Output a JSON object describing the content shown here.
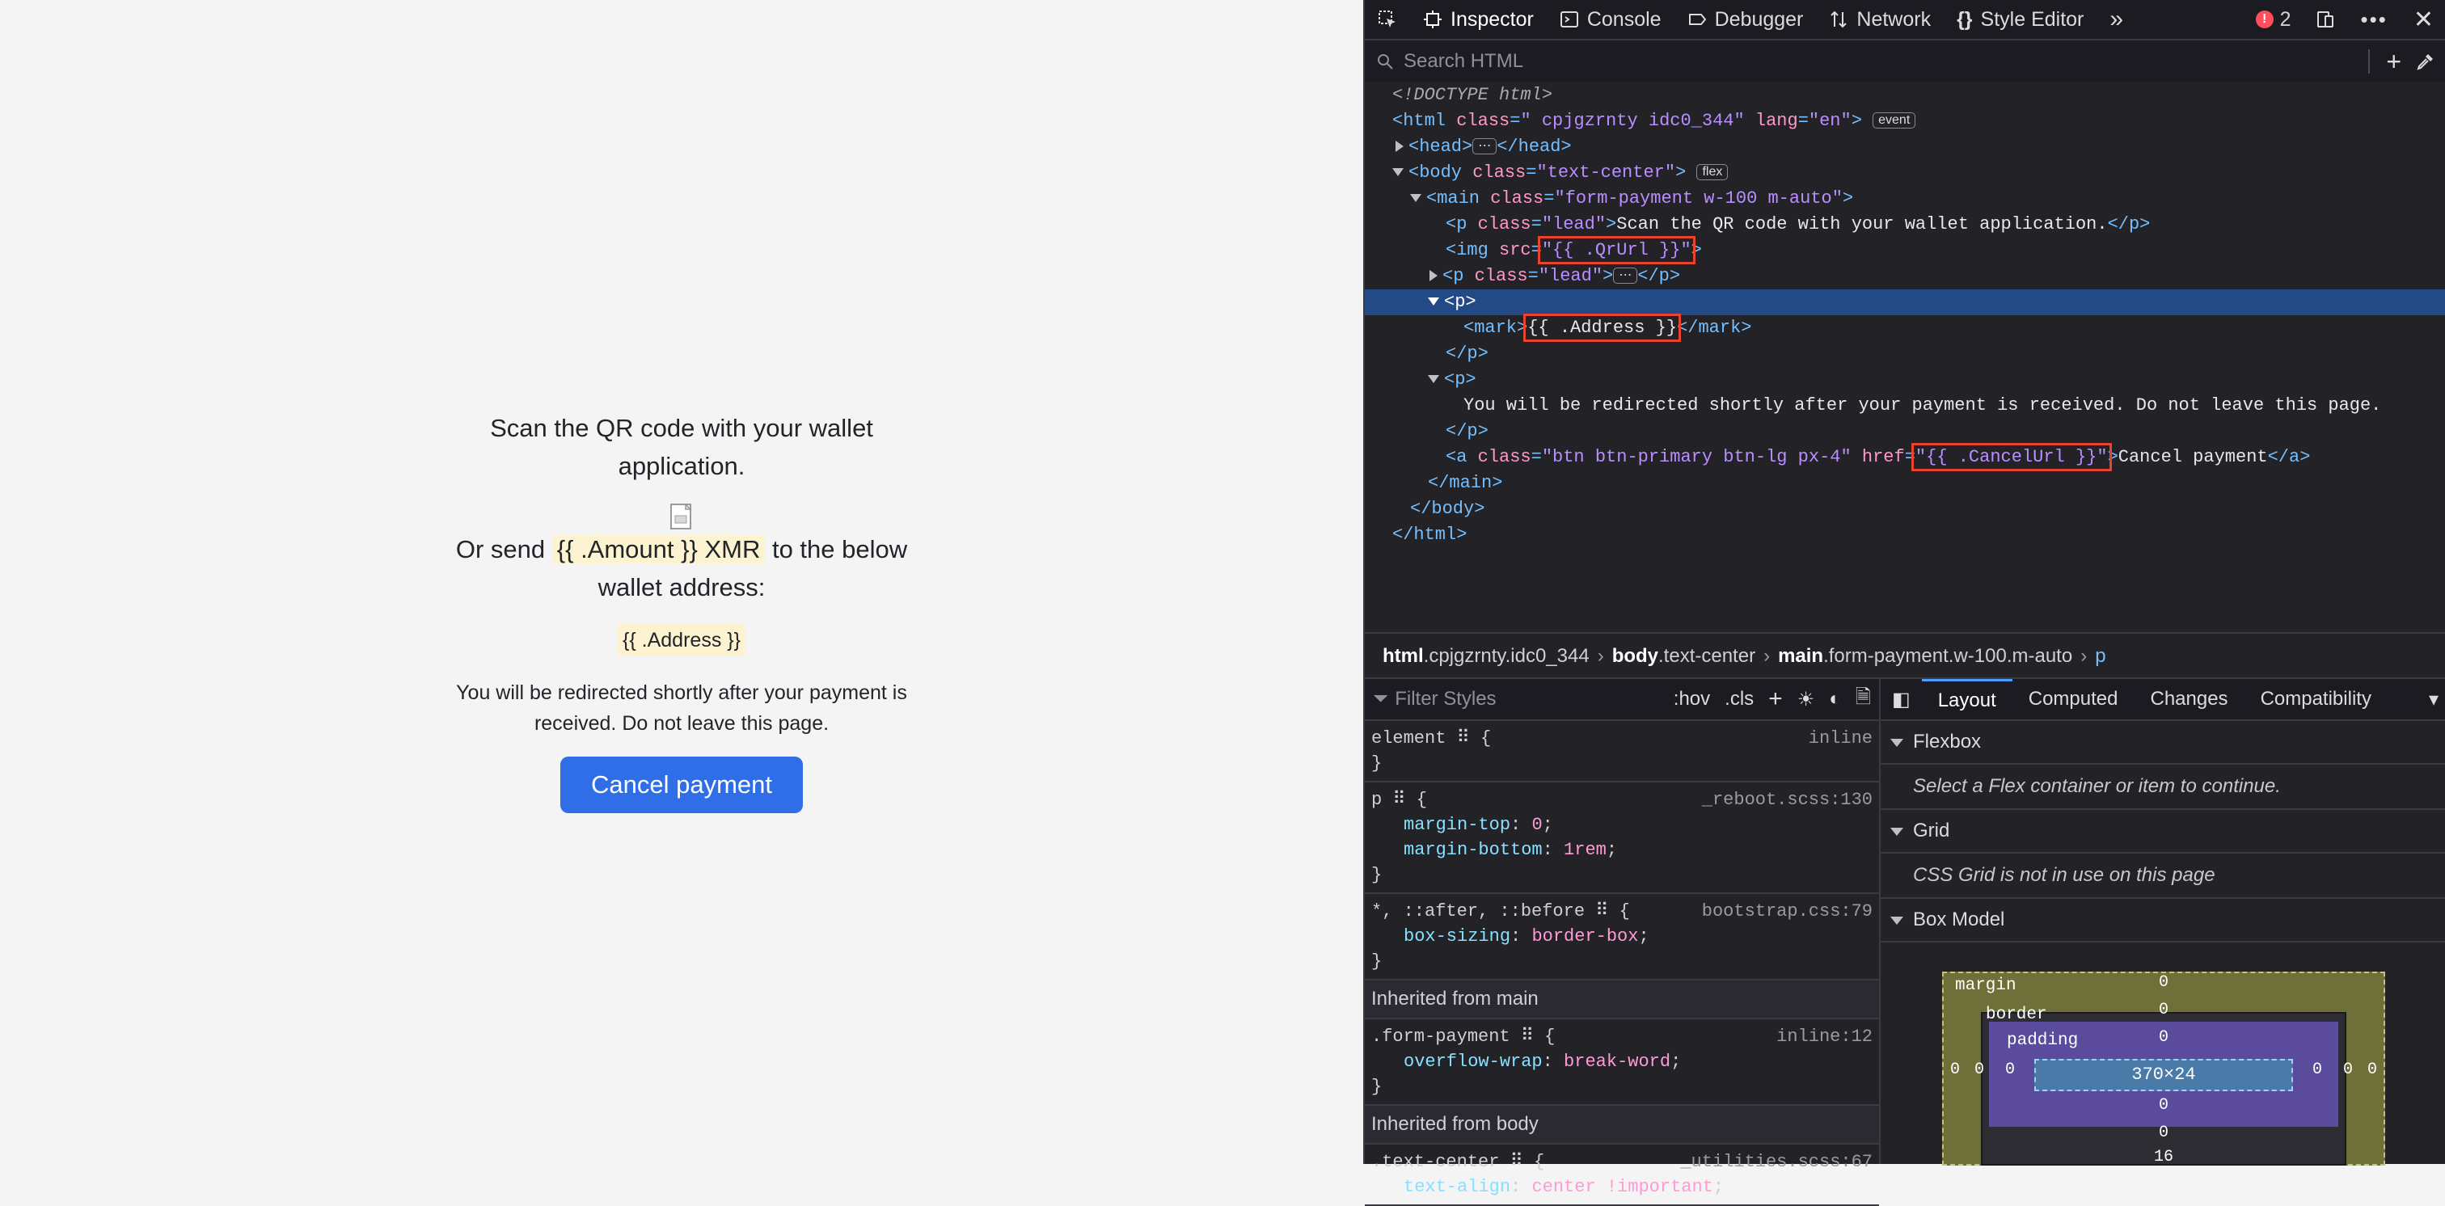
{
  "page": {
    "lead1": "Scan the QR code with your wallet application.",
    "lead2_prefix": "Or send",
    "amount": "{{ .Amount }} XMR",
    "lead2_suffix": "to the below wallet address:",
    "address": "{{ .Address }}",
    "note": "You will be redirected shortly after your payment is received. Do not leave this page.",
    "cancel_button": "Cancel payment"
  },
  "devtools": {
    "tabs": [
      "Inspector",
      "Console",
      "Debugger",
      "Network",
      "Style Editor"
    ],
    "error_count": "2",
    "search_placeholder": "Search HTML",
    "markup": {
      "doctype": "<!DOCTYPE html>",
      "html_class": "\" cpjgzrnty idc0_344\"",
      "html_lang": "\"en\"",
      "event_pill": "event",
      "flex_pill": "flex",
      "body_class": "\"text-center\"",
      "main_class": "\"form-payment w-100 m-auto\"",
      "p_lead_class": "\"lead\"",
      "p_lead_text": "Scan the QR code with your wallet application.",
      "img_src": "\"{{ .QrUrl }}\"",
      "mark_text": "{{ .Address }}",
      "p2_text": "You will be redirected shortly after your payment is received. Do not leave this page.",
      "a_class": "\"btn btn-primary btn-lg px-4\"",
      "a_href": "\"{{ .CancelUrl }}\"",
      "a_text": "Cancel payment"
    },
    "breadcrumbs": [
      {
        "bold": "html",
        "rest": ".cpjgzrnty.idc0_344"
      },
      {
        "bold": "body",
        "rest": ".text-center"
      },
      {
        "bold": "main",
        "rest": ".form-payment.w-100.m-auto"
      },
      {
        "bold": "",
        "rest": "p"
      }
    ],
    "rules": {
      "filter_placeholder": "Filter Styles",
      "hov": ":hov",
      "cls": ".cls",
      "element_selector": "element",
      "element_src": "inline",
      "p_selector": "p",
      "p_src": "_reboot.scss:130",
      "p_prop1_name": "margin-top",
      "p_prop1_val": "0",
      "p_prop2_name": "margin-bottom",
      "p_prop2_val": "1rem",
      "star_selector": "*, ::after, ::before",
      "star_src": "bootstrap.css:79",
      "star_prop_name": "box-sizing",
      "star_prop_val": "border-box",
      "inherit_main": "Inherited from main",
      "fp_selector": ".form-payment",
      "fp_src": "inline:12",
      "fp_prop_name": "overflow-wrap",
      "fp_prop_val": "break-word",
      "inherit_body": "Inherited from body",
      "tc_selector": ".text-center",
      "tc_src": "_utilities.scss:67",
      "tc_prop_name": "text-align",
      "tc_prop_val": "center !important"
    },
    "layout": {
      "tabs": [
        "Layout",
        "Computed",
        "Changes",
        "Compatibility"
      ],
      "flexbox_hdr": "Flexbox",
      "flexbox_msg": "Select a Flex container or item to continue.",
      "grid_hdr": "Grid",
      "grid_msg": "CSS Grid is not in use on this page",
      "boxmodel_hdr": "Box Model",
      "bm_margin": "margin",
      "bm_border": "border",
      "bm_padding": "padding",
      "bm_content": "370×24",
      "bm_zero": "0",
      "bm_bottom_margin": "16"
    }
  },
  "colors": {
    "accent": "#2f6ee6",
    "highlight": "#fdf3d0",
    "selection": "#234a84",
    "annotation": "#e8432d"
  }
}
